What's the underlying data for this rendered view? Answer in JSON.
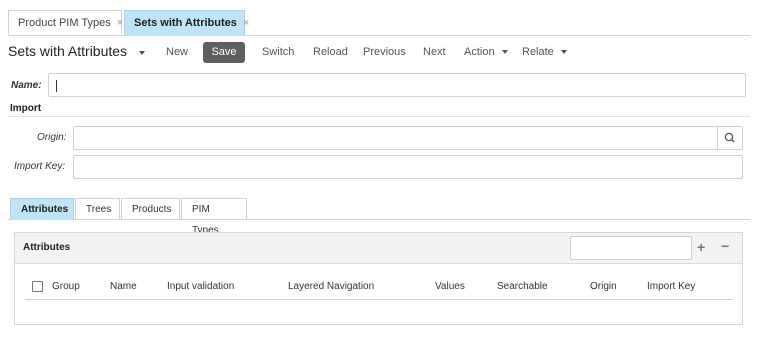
{
  "tabs": [
    {
      "label": "Product PIM Types",
      "close": "×"
    },
    {
      "label": "Sets with Attributes",
      "close": "×"
    }
  ],
  "toolbar": {
    "title": "Sets with Attributes",
    "new": "New",
    "save": "Save",
    "switch": "Switch",
    "reload": "Reload",
    "previous": "Previous",
    "next": "Next",
    "action": "Action",
    "relate": "Relate"
  },
  "form": {
    "name_label": "Name:",
    "name_value": "",
    "import_section": "Import",
    "origin_label": "Origin:",
    "origin_value": "",
    "import_key_label": "Import Key:",
    "import_key_value": ""
  },
  "subtabs": [
    "Attributes",
    "Trees",
    "Products",
    "PIM Types"
  ],
  "attributes_panel": {
    "title": "Attributes",
    "search_value": "",
    "add": "+",
    "remove": "−",
    "columns": [
      "Group",
      "Name",
      "Input validation",
      "Layered Navigation",
      "Values",
      "Searchable",
      "Origin",
      "Import Key"
    ],
    "rows": []
  },
  "colors": {
    "active_tab": "#bfe3f7",
    "save_button": "#5f5f5f",
    "panel_header": "#f3f3f3"
  }
}
